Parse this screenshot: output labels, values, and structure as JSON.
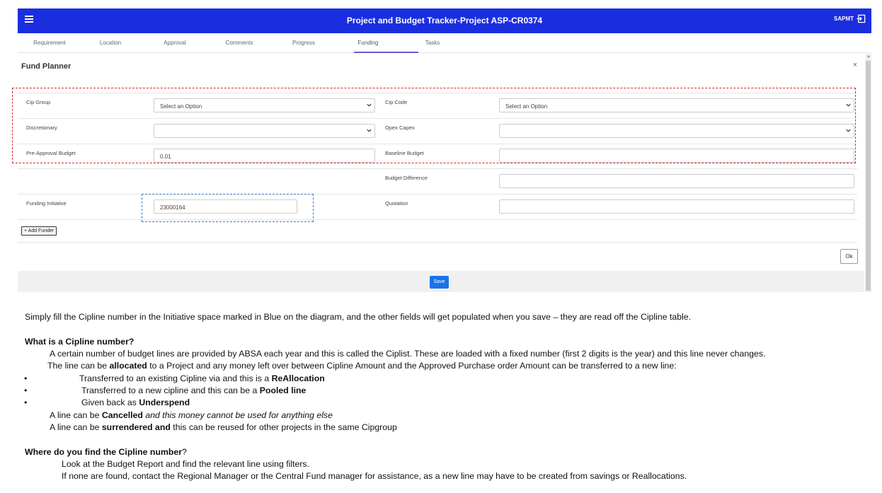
{
  "header": {
    "title": "Project and Budget Tracker-Project ASP-CR0374",
    "user": "SAPMT"
  },
  "tabs": [
    "Requirement",
    "Location",
    "Approval",
    "Comments",
    "Progress",
    "Funding",
    "Tasks"
  ],
  "active_tab": "Funding",
  "panel": {
    "title": "Fund Planner",
    "close": "×"
  },
  "form": {
    "cip_group": {
      "label": "Cip Group",
      "value": "Select an Option"
    },
    "cip_code": {
      "label": "Cip Code",
      "value": "Select an Option"
    },
    "discretionary": {
      "label": "Discretionary",
      "value": ""
    },
    "opex_capex": {
      "label": "Opex Capex",
      "value": ""
    },
    "pre_approval_budget": {
      "label": "Pre-Approval Budget",
      "value": "0.01"
    },
    "baseline_budget": {
      "label": "Baseline Budget",
      "value": ""
    },
    "budget_difference": {
      "label": "Budget Difference",
      "value": ""
    },
    "funding_initiative": {
      "label": "Funding Initiative",
      "value": "23000164"
    },
    "quotation": {
      "label": "Quotation",
      "value": ""
    }
  },
  "buttons": {
    "add_funder": "+ Add Funder",
    "ok": "Ok",
    "save": "Save"
  },
  "notes": {
    "intro": "Simply fill  the Cipline number in the Initiative space marked in Blue on the diagram, and the other fields will get populated when you save – they are read off the Cipline table.",
    "q1": "What is a Cipline number?",
    "p1": "A certain number of budget lines are provided by ABSA each year and this is called the Ciplist. These are loaded with a fixed number (first 2 digits is  the year) and this line never changes.",
    "p2_a": "The line can be ",
    "p2_b": "allocated",
    "p2_c": " to a Project and any money left over between Cipline Amount and the Approved Purchase order Amount can be transferred to a new line:",
    "b1_a": "Transferred to an existing Cipline via  and this is a ",
    "b1_b": "ReAllocation",
    "b2_a": "Transferred to a new cipline and this can be a ",
    "b2_b": "Pooled line",
    "b3_a": "Given back as ",
    "b3_b": "Underspend",
    "p3_a": "A line can be ",
    "p3_b": "Cancelled",
    "p3_c": " and this money cannot be used for anything else",
    "p4_a": "A line can be ",
    "p4_b": "surrendered and",
    "p4_c": " this can be reused for other projects in the same Cipgroup",
    "q2_a": "Where do you find the Cipline number",
    "q2_b": "?",
    "p5": "Look at the Budget Report and find the relevant line using filters.",
    "p6": "If none are found, contact the Regional Manager or the Central Fund manager for assistance, as a new line may have to be created from savings or Reallocations.",
    "bullet": "•"
  },
  "colors": {
    "header_bg": "#1a2ee0",
    "active_tab_underline": "#6a5acd",
    "red_annotation": "#e0242a",
    "blue_annotation": "#2a7fd0",
    "save_button": "#1a73e8"
  }
}
